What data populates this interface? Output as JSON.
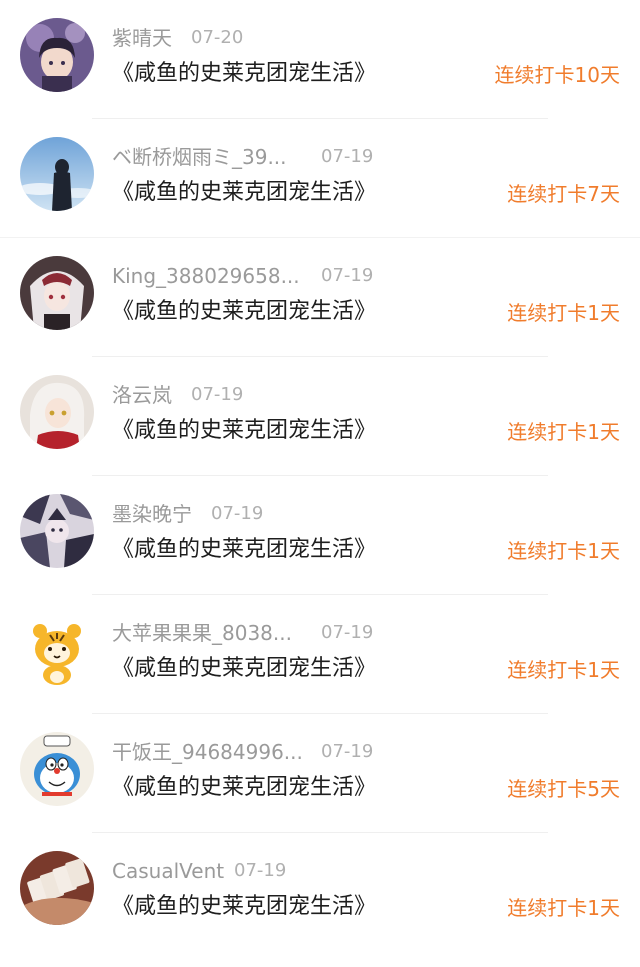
{
  "items": [
    {
      "username": "紫晴天",
      "date": "07-20",
      "book_title": "《咸鱼的史莱克团宠生活》",
      "streak": "连续打卡10天",
      "avatar_icon": "anime-girl-purple-avatar"
    },
    {
      "username": "ベ断桥烟雨ミ_39...",
      "date": "07-19",
      "book_title": "《咸鱼的史莱克团宠生活》",
      "streak": "连续打卡7天",
      "avatar_icon": "silhouette-sky-avatar"
    },
    {
      "username": "King_388029658...",
      "date": "07-19",
      "book_title": "《咸鱼的史莱克团宠生活》",
      "streak": "连续打卡1天",
      "avatar_icon": "anime-maid-avatar"
    },
    {
      "username": "洛云岚",
      "date": "07-19",
      "book_title": "《咸鱼的史莱克团宠生活》",
      "streak": "连续打卡1天",
      "avatar_icon": "anime-white-hair-avatar"
    },
    {
      "username": "墨染晚宁",
      "date": "07-19",
      "book_title": "《咸鱼的史莱克团宠生活》",
      "streak": "连续打卡1天",
      "avatar_icon": "anime-collage-avatar"
    },
    {
      "username": "大苹果果果_8038...",
      "date": "07-19",
      "book_title": "《咸鱼的史莱克团宠生活》",
      "streak": "连续打卡1天",
      "avatar_icon": "cartoon-tiger-avatar"
    },
    {
      "username": "干饭王_94684996...",
      "date": "07-19",
      "book_title": "《咸鱼的史莱克团宠生活》",
      "streak": "连续打卡5天",
      "avatar_icon": "doraemon-avatar"
    },
    {
      "username": "CasualVent",
      "date": "07-19",
      "book_title": "《咸鱼的史莱克团宠生活》",
      "streak": "连续打卡1天",
      "avatar_icon": "playing-cards-avatar"
    }
  ],
  "colors": {
    "streak": "#f07c2c",
    "username": "#9a9a9a",
    "title": "#1e1e1e"
  }
}
